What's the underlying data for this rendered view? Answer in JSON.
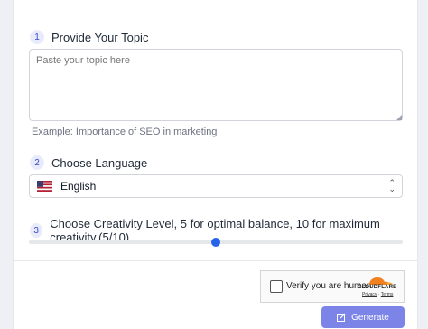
{
  "step1": {
    "number": "1",
    "title": "Provide Your Topic",
    "placeholder": "Paste your topic here",
    "example": "Example:  Importance of SEO in marketing"
  },
  "step2": {
    "number": "2",
    "title": "Choose Language",
    "selected": "English",
    "flag_icon": "us-flag-icon"
  },
  "step3": {
    "number": "3",
    "title": "Choose Creativity Level, 5 for optimal balance, 10 for maximum creativity.(5/10)",
    "value": 5,
    "min": 0,
    "max": 10
  },
  "captcha": {
    "label": "Verify you are human",
    "brand": "CLOUDFLARE",
    "privacy": "Privacy",
    "sep": "·",
    "terms": "Terms"
  },
  "generate": {
    "label": "Generate",
    "icon": "edit-icon"
  },
  "colors": {
    "accent": "#2563eb",
    "button": "#7c84e8",
    "cloudflare": "#f38020"
  }
}
